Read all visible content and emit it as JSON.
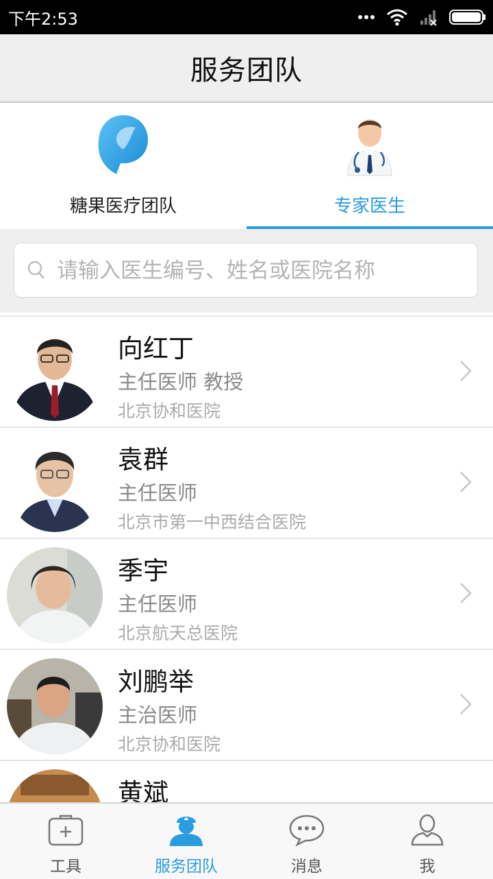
{
  "status": {
    "time": "下午2:53"
  },
  "header": {
    "title": "服务团队"
  },
  "team_tabs": [
    {
      "label": "糖果医疗团队",
      "icon": "tangguo-logo-icon",
      "active": false
    },
    {
      "label": "专家医生",
      "icon": "doctor-icon",
      "active": true
    }
  ],
  "search": {
    "placeholder": "请输入医生编号、姓名或医院名称",
    "value": ""
  },
  "doctors": [
    {
      "name": "向红丁",
      "title": "主任医师  教授",
      "hospital": "北京协和医院"
    },
    {
      "name": "袁群",
      "title": "主任医师",
      "hospital": "北京市第一中西结合医院"
    },
    {
      "name": "季宇",
      "title": "主任医师",
      "hospital": "北京航天总医院"
    },
    {
      "name": "刘鹏举",
      "title": "主治医师",
      "hospital": "北京协和医院"
    },
    {
      "name": "黄斌",
      "title": "",
      "hospital": ""
    }
  ],
  "bottom_nav": [
    {
      "label": "工具",
      "icon": "medkit-icon",
      "active": false
    },
    {
      "label": "服务团队",
      "icon": "nurse-user-icon",
      "active": true
    },
    {
      "label": "消息",
      "icon": "chat-bubble-icon",
      "active": false
    },
    {
      "label": "我",
      "icon": "user-icon",
      "active": false
    }
  ],
  "colors": {
    "accent": "#2a9ce0",
    "header_bg": "#efefef",
    "status_bg": "#000000"
  }
}
